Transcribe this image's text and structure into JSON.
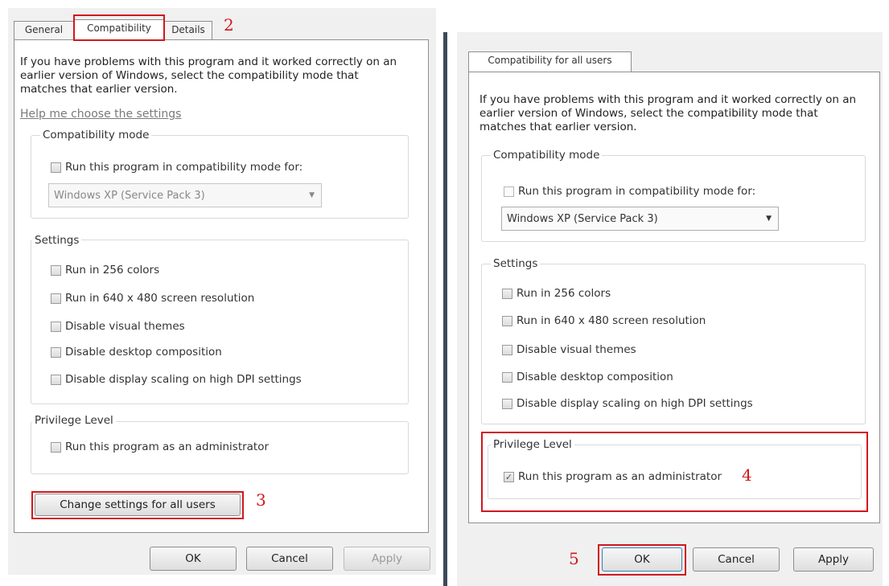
{
  "left": {
    "tabs": [
      "General",
      "Compatibility",
      "Details"
    ],
    "intro": "If you have problems with this program and it worked correctly on an earlier version of Windows, select the compatibility mode that matches that earlier version.",
    "help_link": "Help me choose the settings",
    "compat_mode": {
      "title": "Compatibility mode",
      "checkbox_label": "Run this program in compatibility mode for:",
      "select_value": "Windows XP (Service Pack 3)"
    },
    "settings": {
      "title": "Settings",
      "items": [
        "Run in 256 colors",
        "Run in 640 x 480 screen resolution",
        "Disable visual themes",
        "Disable desktop composition",
        "Disable display scaling on high DPI settings"
      ]
    },
    "privilege": {
      "title": "Privilege Level",
      "checkbox_label": "Run this program as an administrator"
    },
    "change_button": "Change settings for all users",
    "buttons": {
      "ok": "OK",
      "cancel": "Cancel",
      "apply": "Apply"
    }
  },
  "right": {
    "tab": "Compatibility for all users",
    "intro": "If you have problems with this program and it worked correctly on an earlier version of Windows, select the compatibility mode that matches that earlier version.",
    "compat_mode": {
      "title": "Compatibility mode",
      "checkbox_label": "Run this program in compatibility mode for:",
      "select_value": "Windows XP (Service Pack 3)"
    },
    "settings": {
      "title": "Settings",
      "items": [
        "Run in 256 colors",
        "Run in 640 x 480 screen resolution",
        "Disable visual themes",
        "Disable desktop composition",
        "Disable display scaling on high DPI settings"
      ]
    },
    "privilege": {
      "title": "Privilege Level",
      "checkbox_label": "Run this program as an administrator",
      "checked_mark": "✓"
    },
    "buttons": {
      "ok": "OK",
      "cancel": "Cancel",
      "apply": "Apply"
    }
  },
  "annotations": {
    "step2": "2",
    "step3": "3",
    "step4": "4",
    "step5": "5"
  },
  "colors": {
    "annotation_red": "#d0181e",
    "divider": "#3c4a59",
    "dialog_bg": "#f0f0f0"
  }
}
